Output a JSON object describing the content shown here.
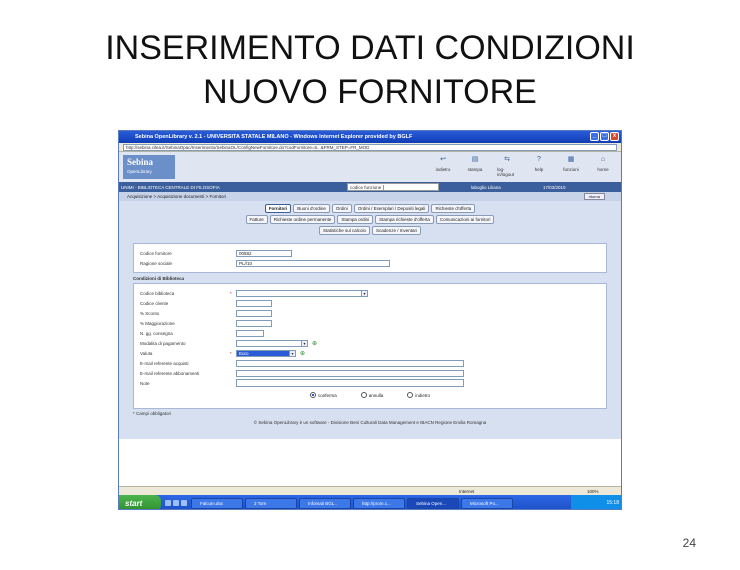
{
  "slide": {
    "title_line1": "INSERIMENTO DATI CONDIZIONI",
    "title_line2": "NUOVO FORNITORE",
    "page_number": "24"
  },
  "window": {
    "title": "Sebina OpenLibrary v. 2.1 - UNIVERSITA STATALE MILANO - Windows Internet Explorer provided by BGLF",
    "address": "http://sebina.cilea.it/SebinaOpac/Inserimento/SebinaOL/ConfigNewFornitore.do?codFornitore=5...&FRM_STEP=FR_MOD",
    "buttons": {
      "minimize": "_",
      "maximize": "□",
      "close": "x"
    }
  },
  "app": {
    "logo_name": "Sebina",
    "logo_sub": "OpenLibrary",
    "toolbar": [
      {
        "label": "indietro",
        "icon": "back-icon"
      },
      {
        "label": "stampa",
        "icon": "print-icon"
      },
      {
        "label": "log-in/logout",
        "icon": "login-icon"
      },
      {
        "label": "help",
        "icon": "help-icon"
      },
      {
        "label": "funzioni",
        "icon": "functions-icon"
      },
      {
        "label": "home",
        "icon": "home-icon"
      }
    ],
    "infobar": {
      "library": "UNIMI - BIBLIOTECA CENTRALE DI FILOSOFIA",
      "function_label": "codice funzione",
      "user": "laboglio Liliana",
      "date": "17/03/2010"
    },
    "breadcrumb": "Acquisizione > Acquisizione documenti > Fornitori",
    "back_label": "ritorna"
  },
  "tabs": {
    "row1": [
      "Fornitori",
      "Buoni d'ordine",
      "Ordini",
      "Ordini / Esemplari / Depositi legali",
      "Richieste d'offerta"
    ],
    "row2": [
      "Fatture",
      "Richieste ordine permanente",
      "Stampa ordini",
      "Stampa richieste d'offerta",
      "Comunicazioni ai fornitori"
    ],
    "row3": [
      "Statistiche sul calcolo",
      "Scadenze / Inventari"
    ],
    "active": "Fornitori"
  },
  "form": {
    "fornitore": {
      "codice_label": "Codice fornitore",
      "codice_value": "00582",
      "ragione_label": "Ragione sociale",
      "ragione_value": "PL//10"
    },
    "section_title": "Condizioni di Biblioteca",
    "fields": [
      {
        "label": "Codice biblioteca",
        "required": "*",
        "value": "",
        "type": "select"
      },
      {
        "label": "Codice cliente",
        "required": "",
        "value": "",
        "type": "text"
      },
      {
        "label": "% Sconto",
        "required": "",
        "value": "",
        "type": "text"
      },
      {
        "label": "% Maggiorazione",
        "required": "",
        "value": "",
        "type": "text"
      },
      {
        "label": "N. gg. consegna",
        "required": "",
        "value": "",
        "type": "text"
      },
      {
        "label": "Modalita di pagamento",
        "required": "",
        "value": "",
        "type": "select"
      },
      {
        "label": "Valuta",
        "required": "*",
        "value": "Euro",
        "type": "select"
      },
      {
        "label": "E-mail referente acquisti",
        "required": "",
        "value": "",
        "type": "text"
      },
      {
        "label": "E-mail referente abbonamenti",
        "required": "",
        "value": "",
        "type": "text"
      },
      {
        "label": "Note",
        "required": "",
        "value": "",
        "type": "text"
      }
    ],
    "actions": [
      "conferma",
      "annulla",
      "indietro"
    ],
    "selected_action": "conferma",
    "footnote": "* Campi obbligatori"
  },
  "copyright": "© Sebina OpenLibrary è un software - Divisione Beni Culturali Data Management e IBACN Regione Emilia Romagna",
  "statusbar": {
    "zone": "Internet",
    "zoom": "100%"
  },
  "taskbar": {
    "start": "start",
    "tasks": [
      "Falcom.doc",
      "2 Torn",
      "Infomati BGL..",
      "http://prom.c...",
      "Sebina Open...",
      "Microsoft Po...",
      "Sebina Open..."
    ],
    "active_task": "Sebina Open...",
    "clock": "15:18"
  },
  "colors": {
    "titlebar": "#0f3db4",
    "infobar": "#3b5f9c",
    "panel": "#d6e0f0",
    "taskbar": "#1d4fc4",
    "start": "#2e8f2e"
  }
}
